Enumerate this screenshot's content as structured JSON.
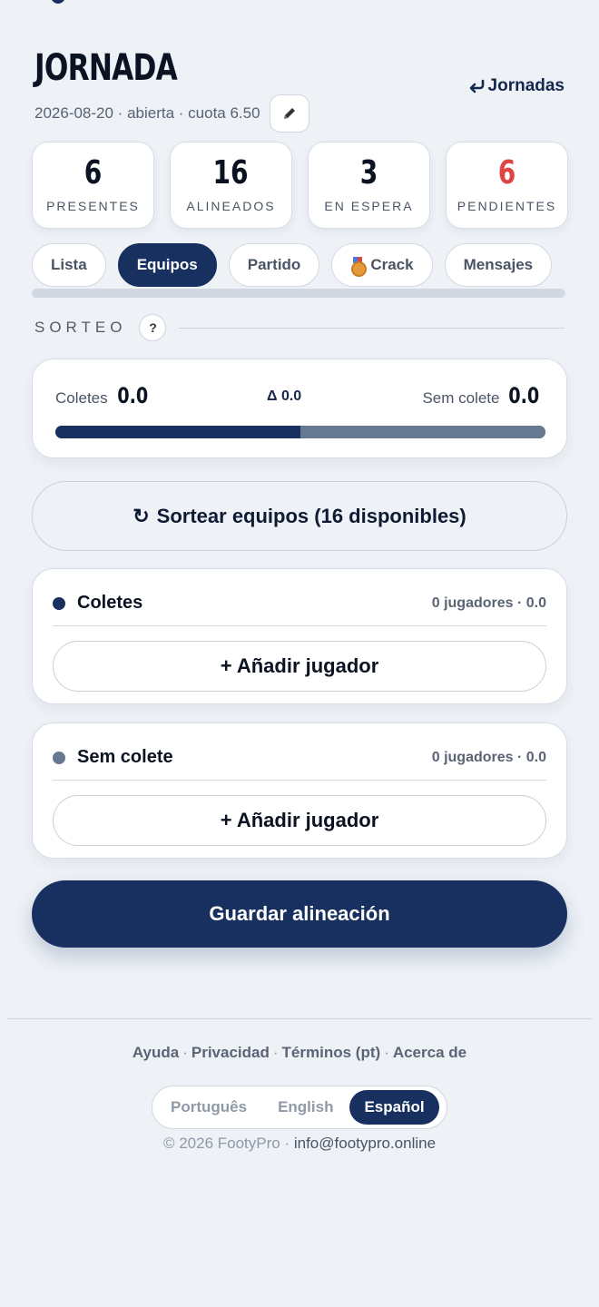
{
  "header": {
    "title": "JORNADA",
    "back_label": "Jornadas",
    "back_icon": "return-arrow-icon",
    "meta": "2026-08-20 · abierta · cuota 6.50",
    "edit_icon": "pencil-icon"
  },
  "stats": [
    {
      "value": "6",
      "label": "PRESENTES"
    },
    {
      "value": "16",
      "label": "ALINEADOS"
    },
    {
      "value": "3",
      "label": "EN ESPERA"
    },
    {
      "value": "6",
      "label": "PENDIENTES",
      "color": "#e04545"
    }
  ],
  "tabs": [
    {
      "label": "Lista"
    },
    {
      "label": "Equipos",
      "active": true
    },
    {
      "label": "Partido"
    },
    {
      "label": "Crack",
      "icon": "medal-icon"
    },
    {
      "label": "Mensajes"
    }
  ],
  "section": {
    "title": "SORTEO",
    "help": "?"
  },
  "balance": {
    "team_a": {
      "name": "Coletes",
      "value": "0.0"
    },
    "delta": "Δ 0.0",
    "team_b": {
      "name": "Sem colete",
      "value": "0.0"
    },
    "team_a_share": 0.5
  },
  "draw_button": {
    "icon": "↻",
    "label": "Sortear equipos (16 disponibles)"
  },
  "teams": [
    {
      "name": "Coletes",
      "meta": "0 jugadores · 0.0",
      "color": "#17305f",
      "add_label": "+ Añadir jugador"
    },
    {
      "name": "Sem colete",
      "meta": "0 jugadores · 0.0",
      "color": "#667892",
      "add_label": "+ Añadir jugador"
    }
  ],
  "save_button": {
    "label": "Guardar alineación"
  },
  "footer": {
    "links": [
      "Ayuda",
      "Privacidad",
      "Términos (pt)",
      "Acerca de"
    ],
    "separator": "·",
    "languages": [
      {
        "label": "Português"
      },
      {
        "label": "English"
      },
      {
        "label": "Español",
        "active": true
      }
    ],
    "copyright": "© 2026 FootyPro ·",
    "email": "info@footypro.online"
  },
  "colors": {
    "primary": "#17305f",
    "background": "#eef2f7",
    "alert": "#e04545"
  }
}
